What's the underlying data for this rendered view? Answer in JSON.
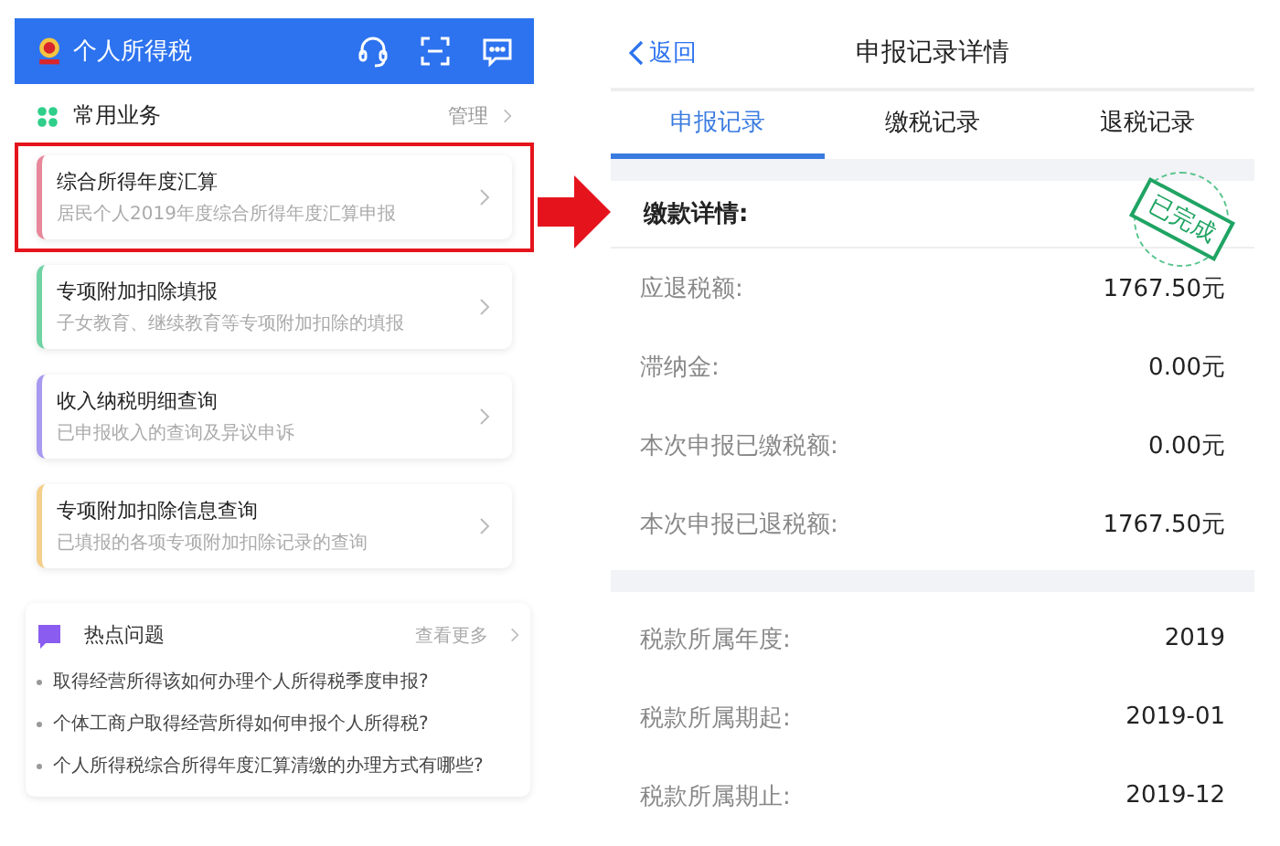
{
  "left_screen": {
    "header": {
      "title": "个人所得税"
    },
    "section": {
      "title": "常用业务",
      "action": "管理"
    },
    "cards": [
      {
        "title": "综合所得年度汇算",
        "subtitle": "居民个人2019年度综合所得年度汇算申报",
        "color": "#e8879a",
        "highlighted": true
      },
      {
        "title": "专项附加扣除填报",
        "subtitle": "子女教育、继续教育等专项附加扣除的填报",
        "color": "#6fd3a4",
        "highlighted": false
      },
      {
        "title": "收入纳税明细查询",
        "subtitle": "已申报收入的查询及异议申诉",
        "color": "#a79af0",
        "highlighted": false
      },
      {
        "title": "专项附加扣除信息查询",
        "subtitle": "已填报的各项专项附加扣除记录的查询",
        "color": "#f3cf8a",
        "highlighted": false
      }
    ],
    "hot_questions": {
      "title": "热点问题",
      "more": "查看更多",
      "items": [
        "取得经营所得该如何办理个人所得税季度申报?",
        "个体工商户取得经营所得如何申报个人所得税?",
        "个人所得税综合所得年度汇算清缴的办理方式有哪些?"
      ]
    }
  },
  "right_screen": {
    "nav": {
      "back": "返回",
      "title": "申报记录详情"
    },
    "tabs": [
      {
        "label": "申报记录",
        "selected": true
      },
      {
        "label": "缴税记录",
        "selected": false
      },
      {
        "label": "退税记录",
        "selected": false
      }
    ],
    "section_title": "缴款详情:",
    "stamp": "已完成",
    "groups": [
      [
        {
          "label": "应退税额:",
          "value": "1767.50元"
        },
        {
          "label": "滞纳金:",
          "value": "0.00元"
        },
        {
          "label": "本次申报已缴税额:",
          "value": "0.00元"
        },
        {
          "label": "本次申报已退税额:",
          "value": "1767.50元"
        }
      ],
      [
        {
          "label": "税款所属年度:",
          "value": "2019"
        },
        {
          "label": "税款所属期起:",
          "value": "2019-01"
        },
        {
          "label": "税款所属期止:",
          "value": "2019-12"
        }
      ]
    ]
  }
}
